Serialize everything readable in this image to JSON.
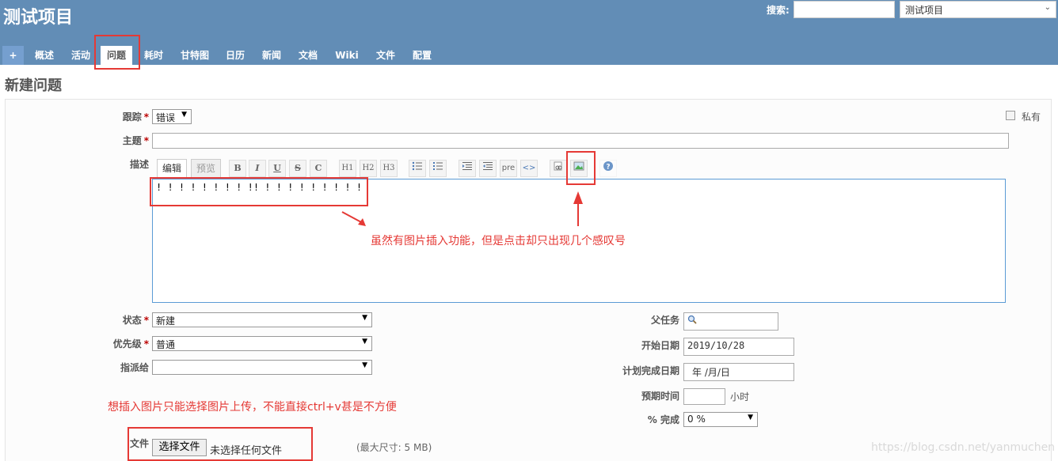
{
  "header": {
    "project_title": "测试项目",
    "search_label": "搜索:",
    "search_value": "",
    "project_jump": "测试项目"
  },
  "tabs": [
    {
      "label": "+"
    },
    {
      "label": "概述"
    },
    {
      "label": "活动"
    },
    {
      "label": "问题"
    },
    {
      "label": "耗时"
    },
    {
      "label": "甘特图"
    },
    {
      "label": "日历"
    },
    {
      "label": "新闻"
    },
    {
      "label": "文档"
    },
    {
      "label": "Wiki"
    },
    {
      "label": "文件"
    },
    {
      "label": "配置"
    }
  ],
  "page_title": "新建问题",
  "form": {
    "tracker_label": "跟踪",
    "tracker_value": "错误",
    "private_label": "私有",
    "subject_label": "主题",
    "subject_value": "",
    "description_label": "描述",
    "editor_tab_edit": "编辑",
    "editor_tab_preview": "预览",
    "description_value": "! ! ! ! ! ! ! ! !! ! ! ! ! ! ! ! ! !",
    "status_label": "状态",
    "status_value": "新建",
    "priority_label": "优先级",
    "priority_value": "普通",
    "assignee_label": "指派给",
    "assignee_value": "",
    "parent_label": "父任务",
    "start_date_label": "开始日期",
    "start_date_value": "2019/10/28",
    "due_date_label": "计划完成日期",
    "due_date_value": "年 /月/日",
    "estimated_label": "预期时间",
    "estimated_unit": "小时",
    "done_label": "% 完成",
    "done_value": "0 %",
    "file_label": "文件",
    "choose_file_button": "选择文件",
    "no_file_text": "未选择任何文件",
    "max_size_text": "(最大尺寸: 5 MB)"
  },
  "toolbar": {
    "bold": "B",
    "italic": "I",
    "underline": "U",
    "strike": "S",
    "code": "C",
    "h1": "H1",
    "h2": "H2",
    "h3": "H3",
    "pre": "pre"
  },
  "annotations": {
    "note_image": "虽然有图片插入功能，但是点击却只出现几个感叹号",
    "note_upload": "想插入图片只能选择图片上传，不能直接ctrl+v甚是不方便"
  },
  "watermark": "https://blog.csdn.net/yanmuchen",
  "colors": {
    "header_bg": "#628db6",
    "annotation_red": "#e53935",
    "required_red": "#bb0000"
  }
}
